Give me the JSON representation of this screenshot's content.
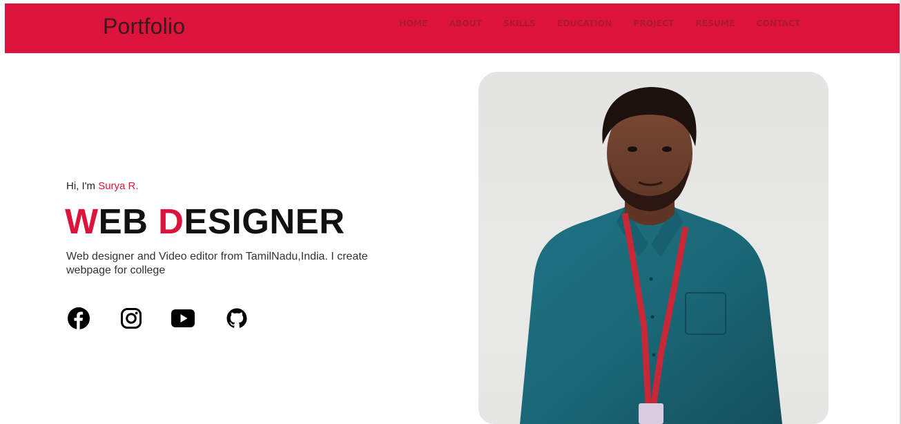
{
  "theme": {
    "accent": "#dc143c",
    "nav_text": "#b0192c"
  },
  "header": {
    "logo": "Portfolio",
    "nav": [
      {
        "label": "HOME"
      },
      {
        "label": "ABOUT"
      },
      {
        "label": "SKILLS"
      },
      {
        "label": "EDUCATION"
      },
      {
        "label": "PROJECT"
      },
      {
        "label": "RESUME"
      },
      {
        "label": "CONTACT"
      }
    ]
  },
  "hero": {
    "greeting_prefix": "Hi, I'm ",
    "name": "Surya R.",
    "title_parts": [
      "W",
      "EB ",
      "D",
      "ESIGNER"
    ],
    "description": "Web designer and Video editor from TamilNadu,India. I create webpage for college"
  },
  "socials": [
    {
      "icon": "facebook-icon"
    },
    {
      "icon": "instagram-icon"
    },
    {
      "icon": "youtube-icon"
    },
    {
      "icon": "github-icon"
    }
  ],
  "photo": {
    "icon": "profile-photo"
  }
}
